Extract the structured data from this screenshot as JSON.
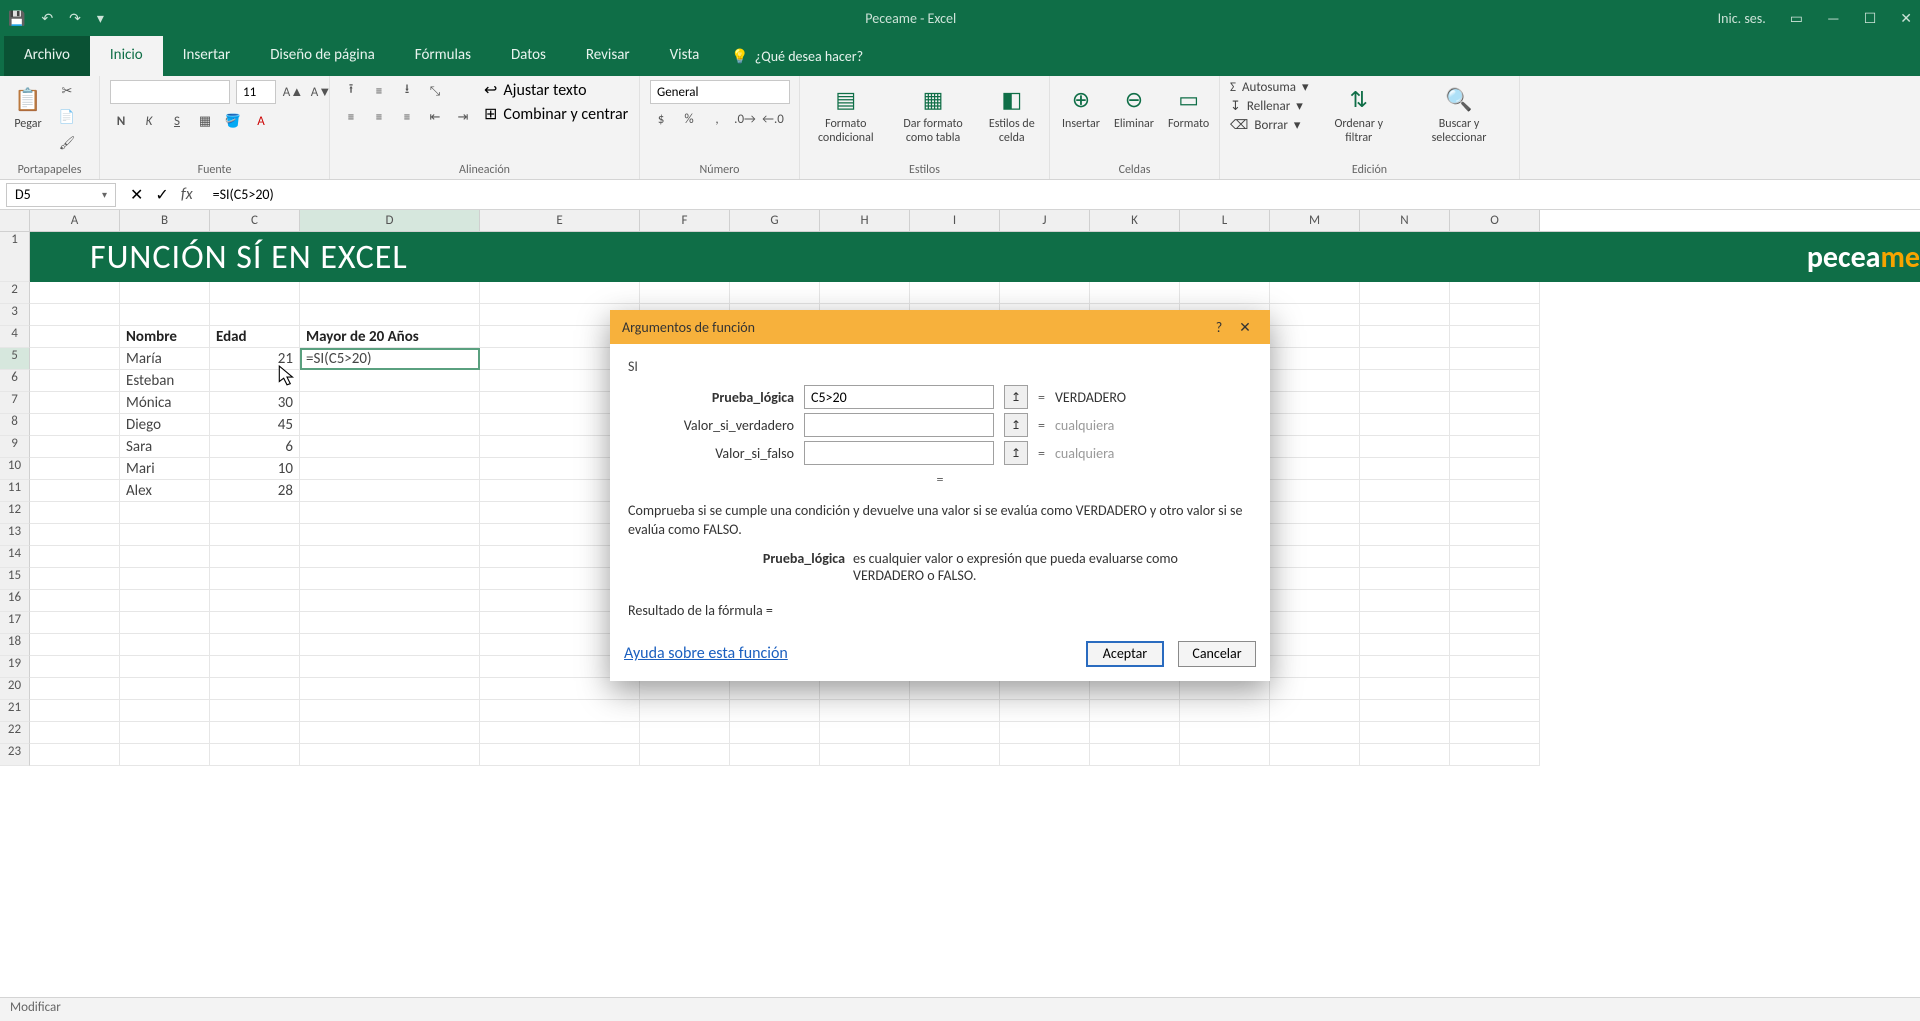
{
  "titlebar": {
    "title": "Peceame - Excel",
    "signin": "Inic. ses."
  },
  "tabs": {
    "file": "Archivo",
    "home": "Inicio",
    "insert": "Insertar",
    "pagelayout": "Diseño de página",
    "formulas": "Fórmulas",
    "data": "Datos",
    "review": "Revisar",
    "view": "Vista",
    "tellme": "¿Qué desea hacer?"
  },
  "ribbon": {
    "clipboard": {
      "label": "Portapapeles",
      "paste": "Pegar"
    },
    "font": {
      "label": "Fuente",
      "font_name": "",
      "font_size": "11",
      "n": "N",
      "k": "K",
      "s": "S"
    },
    "align": {
      "label": "Alineación",
      "wrap": "Ajustar texto",
      "merge": "Combinar y centrar"
    },
    "number": {
      "label": "Número",
      "format": "General"
    },
    "styles": {
      "label": "Estilos",
      "cond": "Formato condicional",
      "table": "Dar formato como tabla",
      "cell": "Estilos de celda"
    },
    "cells": {
      "label": "Celdas",
      "insert": "Insertar",
      "delete": "Eliminar",
      "format": "Formato"
    },
    "editing": {
      "label": "Edición",
      "sum": "Autosuma",
      "fill": "Rellenar",
      "clear": "Borrar",
      "sort": "Ordenar y filtrar",
      "find": "Buscar y seleccionar"
    }
  },
  "namebox": "D5",
  "formula": "=SI(C5>20)",
  "columns": [
    "A",
    "B",
    "C",
    "D",
    "E",
    "F",
    "G",
    "H",
    "I",
    "J",
    "K",
    "L",
    "M",
    "N",
    "O"
  ],
  "banner": {
    "title": "FUNCIÓN SÍ EN EXCEL",
    "logo_left": "pecea",
    "logo_right": "me"
  },
  "headers": {
    "name": "Nombre",
    "age": "Edad",
    "over20": "Mayor de 20 Años"
  },
  "people": [
    {
      "name": "María",
      "age": 21
    },
    {
      "name": "Esteban",
      "age": ""
    },
    {
      "name": "Mónica",
      "age": 30
    },
    {
      "name": "Diego",
      "age": 45
    },
    {
      "name": "Sara",
      "age": 6
    },
    {
      "name": "Mari",
      "age": 10
    },
    {
      "name": "Alex",
      "age": 28
    }
  ],
  "editing_cell": "=SI(C5>20)",
  "dialog": {
    "title": "Argumentos de función",
    "fn": "SI",
    "arg1_label": "Prueba_lógica",
    "arg1_value": "C5>20",
    "arg1_eval": "VERDADERO",
    "arg2_label": "Valor_si_verdadero",
    "arg2_value": "",
    "arg2_eval": "cualquiera",
    "arg3_label": "Valor_si_falso",
    "arg3_value": "",
    "arg3_eval": "cualquiera",
    "eq_alone": "=",
    "desc": "Comprueba si se cumple una condición y devuelve una valor si se evalúa como VERDADERO y otro valor si se evalúa como FALSO.",
    "argdesc_label": "Prueba_lógica",
    "argdesc_text": "es cualquier valor o expresión que pueda evaluarse como VERDADERO o FALSO.",
    "result": "Resultado de la fórmula =",
    "help": "Ayuda sobre esta función",
    "ok": "Aceptar",
    "cancel": "Cancelar",
    "help_icon": "?",
    "close_icon": "✕"
  },
  "status": "Modificar"
}
